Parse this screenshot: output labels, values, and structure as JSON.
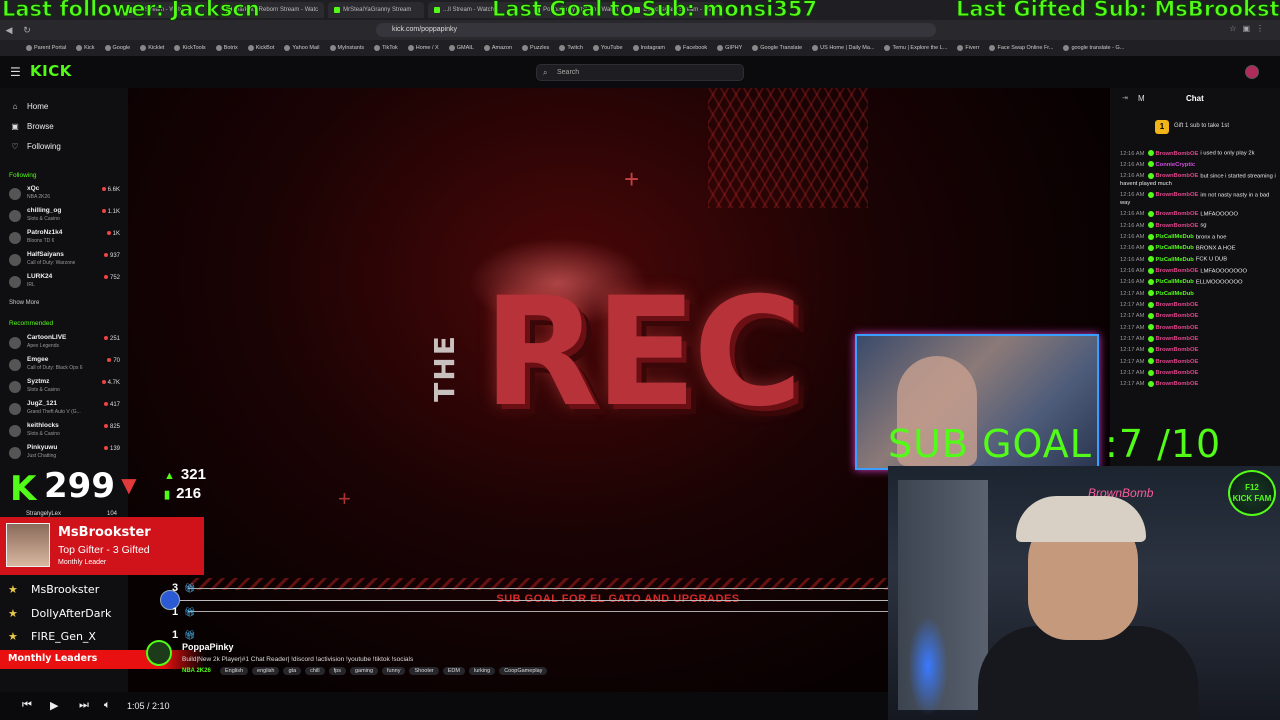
{
  "browser": {
    "tabs": [
      "...x Stream - Watc",
      "DarksideReborn Stream - Watc",
      "MrStealYaGranny Stream",
      "...ll Stream - Watch L",
      "PoppaPinky Stream - Watch",
      "DewditsCam Stream - Wat"
    ],
    "url": "kick.com/poppapinky",
    "bookmarks": [
      "Parent Portal",
      "Kick",
      "Google",
      "Kicklet",
      "KickTools",
      "Botrix",
      "KickBot",
      "Yahoo Mail",
      "MyInstants",
      "TikTok",
      "Home / X",
      "GMAIL",
      "Amazon",
      "Puzzles",
      "Twitch",
      "YouTube",
      "Instagram",
      "Facebook",
      "GIPHY",
      "Google Translate",
      "US Home | Daily Ma...",
      "Temu | Explore the L...",
      "Fiverr",
      "Face Swap Online Fr...",
      "google translate - G..."
    ]
  },
  "header": {
    "logo": "KICK",
    "search_placeholder": "Search"
  },
  "sidebar": {
    "nav": [
      {
        "label": "Home",
        "icon": "home-icon",
        "glyph": "⌂"
      },
      {
        "label": "Browse",
        "icon": "browse-icon",
        "glyph": "▣"
      },
      {
        "label": "Following",
        "icon": "heart-icon",
        "glyph": "♡"
      }
    ],
    "following_heading": "Following",
    "following": [
      {
        "name": "xQc",
        "category": "NBA 2K26",
        "viewers": "6.6K"
      },
      {
        "name": "chilling_og",
        "category": "Slots & Casino",
        "viewers": "1.1K"
      },
      {
        "name": "PatroNz1k4",
        "category": "Bloons TD 6",
        "viewers": "1K"
      },
      {
        "name": "HalfSaiyans",
        "category": "Call of Duty: Warzone",
        "viewers": "937"
      },
      {
        "name": "LURK24",
        "category": "IRL",
        "viewers": "752"
      }
    ],
    "show_more": "Show More",
    "recommended_heading": "Recommended",
    "recommended": [
      {
        "name": "CartoonLIVE",
        "category": "Apex Legends",
        "viewers": "251"
      },
      {
        "name": "Emgee",
        "category": "Call of Duty: Black Ops 6",
        "viewers": "70"
      },
      {
        "name": "Syztmz",
        "category": "Slots & Casino",
        "viewers": "4.7K"
      },
      {
        "name": "JugZ_121",
        "category": "Grand Theft Auto V (G...",
        "viewers": "417"
      },
      {
        "name": "keithlocks",
        "category": "Slots & Casino",
        "viewers": "825"
      },
      {
        "name": "Pinkyuwu",
        "category": "Just Chatting",
        "viewers": "139"
      }
    ],
    "last_row": {
      "name": "StrangelyLex",
      "viewers": "104"
    }
  },
  "overlay": {
    "last_follower": "Last follower: Jackscn",
    "last_goal": "Last Goal to Sub: monsi357",
    "last_gifted": "Last Gifted Sub: MsBrookster",
    "sub_goal": "SUB GOAL :7 /10",
    "followers_count": "299",
    "stat_up": "321",
    "stat_bars": "216",
    "top_gifter": {
      "name": "MsBrookster",
      "title": "Top Gifter - 3 Gifted",
      "subtitle": "Monthly Leader"
    },
    "leaders": [
      {
        "name": "MsBrookster",
        "count": "3"
      },
      {
        "name": "DollyAfterDark",
        "count": "1"
      },
      {
        "name": "FIRE_Gen_X",
        "count": "1"
      }
    ],
    "leaders_label": "Monthly Leaders",
    "video_logo_small": "THE",
    "video_logo_big": "REC",
    "banner_text": "SUB GOAL FOR EL GATO AND UPGRADES",
    "neon_sign": "BrownBomb",
    "badge_line1": "F12",
    "badge_line2": "KICK FAM"
  },
  "stream": {
    "streamer": "PoppaPinky",
    "title": "Build|New 2k Player|#1 Chat Reader| !discord !activision !youtube !tiktok !socials",
    "category": "NBA 2K26",
    "tags": [
      "English",
      "english",
      "gta",
      "chill",
      "fps",
      "gaming",
      "funny",
      "Shooter",
      "EDM",
      "lurking",
      "CoopGameplay"
    ]
  },
  "player": {
    "time": "1:05 / 2:10"
  },
  "chat": {
    "title": "Chat",
    "mode": "M",
    "gift_prompt": "Gift 1 sub to take 1st",
    "messages": [
      {
        "time": "12:16 AM",
        "user": "BrownBombOE",
        "color": "#e0448a",
        "text": "i used to only play 2k"
      },
      {
        "time": "12:16 AM",
        "user": "ConnieCryptic",
        "color": "#d24de0",
        "text": ""
      },
      {
        "time": "12:16 AM",
        "user": "BrownBombOE",
        "color": "#e0448a",
        "text": "but since i started streaming i havent played much"
      },
      {
        "time": "12:16 AM",
        "user": "BrownBombOE",
        "color": "#e0448a",
        "text": "im not nasty nasty in a bad way"
      },
      {
        "time": "12:16 AM",
        "user": "BrownBombOE",
        "color": "#e0448a",
        "text": "LMFAOOOOO"
      },
      {
        "time": "12:16 AM",
        "user": "BrownBombOE",
        "color": "#e0448a",
        "text": "sg"
      },
      {
        "time": "12:16 AM",
        "user": "PlzCallMeDub",
        "color": "#53fc18",
        "text": "bronx a hoe"
      },
      {
        "time": "12:16 AM",
        "user": "PlzCallMeDub",
        "color": "#53fc18",
        "text": "BRONX A HOE"
      },
      {
        "time": "12:16 AM",
        "user": "PlzCallMeDub",
        "color": "#53fc18",
        "text": "FCK U DUB"
      },
      {
        "time": "12:16 AM",
        "user": "BrownBombOE",
        "color": "#e0448a",
        "text": "LMFAOOOOOOO"
      },
      {
        "time": "12:16 AM",
        "user": "PlzCallMeDub",
        "color": "#53fc18",
        "text": "ELLMOOOOOOO"
      },
      {
        "time": "12:17 AM",
        "user": "PlzCallMeDub",
        "color": "#53fc18",
        "text": ""
      },
      {
        "time": "12:17 AM",
        "user": "BrownBombOE",
        "color": "#e0448a",
        "text": ""
      },
      {
        "time": "12:17 AM",
        "user": "BrownBombOE",
        "color": "#e0448a",
        "text": ""
      },
      {
        "time": "12:17 AM",
        "user": "BrownBombOE",
        "color": "#e0448a",
        "text": ""
      },
      {
        "time": "12:17 AM",
        "user": "BrownBombOE",
        "color": "#e0448a",
        "text": ""
      },
      {
        "time": "12:17 AM",
        "user": "BrownBombOE",
        "color": "#e0448a",
        "text": ""
      },
      {
        "time": "12:17 AM",
        "user": "BrownBombOE",
        "color": "#e0448a",
        "text": ""
      },
      {
        "time": "12:17 AM",
        "user": "BrownBombOE",
        "color": "#e0448a",
        "text": ""
      },
      {
        "time": "12:17 AM",
        "user": "BrownBombOE",
        "color": "#e0448a",
        "text": ""
      }
    ]
  },
  "colors": {
    "accent": "#53fc18",
    "gifter": "#d0121b",
    "leaders_bar": "#e81010",
    "banner_text": "#d42a2a"
  }
}
